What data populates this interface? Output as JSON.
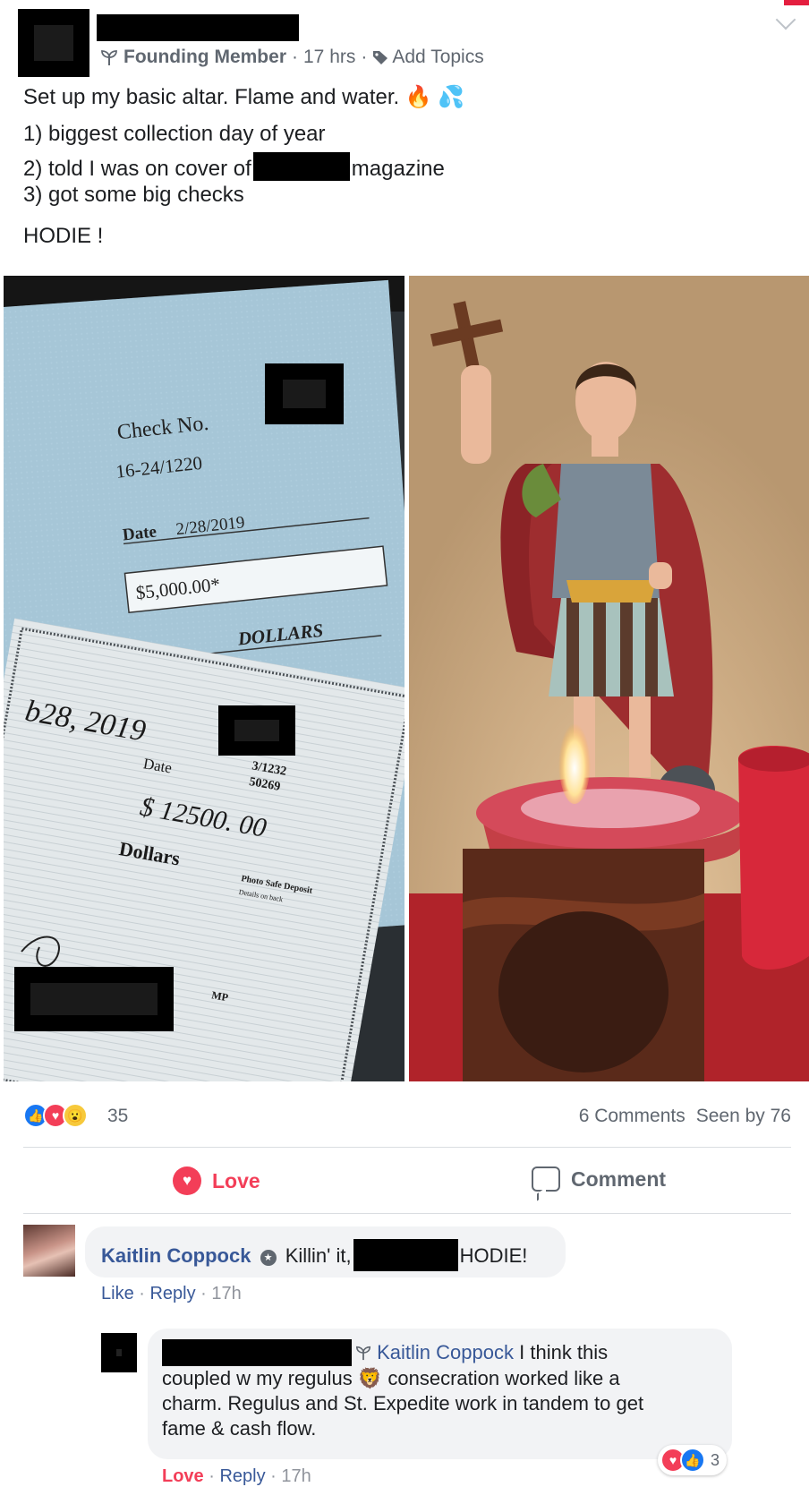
{
  "post": {
    "badge_label": "Founding Member",
    "time": "17 hrs",
    "add_topics": "Add Topics",
    "line1": "Set up my basic altar. Flame and water. 🔥 💦",
    "line2": "1) biggest collection day of year",
    "line3_a": "2) told I was on cover of",
    "line3_b": "magazine",
    "line4": "3) got some big checks",
    "line5": "HODIE !"
  },
  "photos": {
    "left": {
      "check1_label": "Check No.",
      "check1_routing": "16-24/1220",
      "check1_date_label": "Date",
      "check1_date": "2/28/2019",
      "check1_amount": "$5,000.00*",
      "check1_dollars": "DOLLARS",
      "check2_date_handwritten": "b28, 2019",
      "check2_date_label": "Date",
      "check2_routing": "50269",
      "check2_routing_top": "3/1232",
      "check2_amount": "$ 12500. 00",
      "check2_dollars": "Dollars",
      "check2_photo_deposit": "Photo Safe Deposit",
      "check2_details": "Details on back",
      "check2_mp": "MP"
    }
  },
  "stats": {
    "reactions_count": "35",
    "comments": "6 Comments",
    "seen_by": "Seen by 76"
  },
  "actions": {
    "love_label": "Love",
    "comment_label": "Comment"
  },
  "comment1": {
    "author": "Kaitlin Coppock",
    "text_a": "Killin' it,",
    "text_b": "HODIE!",
    "like": "Like",
    "reply": "Reply",
    "time": "17h"
  },
  "reply1": {
    "mention": "Kaitlin Coppock",
    "text_line1": "I think this",
    "text_line2": "coupled w my regulus 🦁 consecration worked like a",
    "text_line3": "charm. Regulus and St. Expedite work in tandem to get",
    "text_line4": "fame & cash flow.",
    "love": "Love",
    "reply": "Reply",
    "time": "17h",
    "reaction_count": "3"
  },
  "icons": {
    "badge": "sprout-icon",
    "topics": "tag-icon",
    "menu": "chevron-down-icon",
    "like": "thumbs-up-icon",
    "love": "heart-icon",
    "wow": "wow-face-icon",
    "comment": "speech-bubble-icon",
    "verified": "verified-badge-icon"
  },
  "colors": {
    "link": "#385898",
    "love": "#f33e58",
    "like": "#1877f2",
    "muted": "#606770"
  }
}
